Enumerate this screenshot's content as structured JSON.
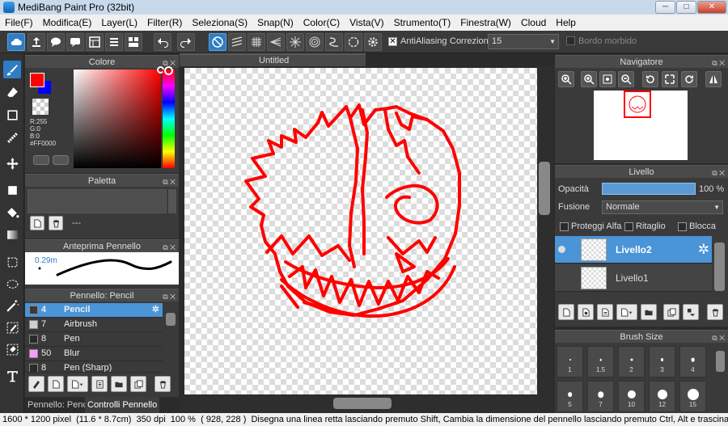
{
  "window": {
    "title": "MediBang Paint Pro (32bit)",
    "minimize": "─",
    "maximize": "□",
    "close": "✕"
  },
  "menu": [
    "File(F)",
    "Modifica(E)",
    "Layer(L)",
    "Filter(R)",
    "Seleziona(S)",
    "Snap(N)",
    "Color(C)",
    "Vista(V)",
    "Strumento(T)",
    "Finestra(W)",
    "Cloud",
    "Help"
  ],
  "toolbar": {
    "antialias_label": "AntiAliasing",
    "correction_label": "Correzione",
    "correction_value": "15",
    "soft_edge_label": "Bordo morbido"
  },
  "color_panel": {
    "title": "Colore",
    "r": "R:255",
    "g": "G:0",
    "b": "B:0",
    "hex": "#FF0000",
    "fg": "#ff0000",
    "bg": "#0000ff"
  },
  "palette_panel": {
    "title": "Paletta",
    "empty_text": "---"
  },
  "brush_preview": {
    "title": "Anteprima Pennello",
    "size": "0.29m"
  },
  "brush_list": {
    "title": "Pennello: Pencil",
    "items": [
      {
        "size": "4",
        "name": "Pencil",
        "swatch": "#3a3a3a"
      },
      {
        "size": "7",
        "name": "Airbrush",
        "swatch": "#cfcfcf"
      },
      {
        "size": "8",
        "name": "Pen",
        "swatch": "#2a2a2a"
      },
      {
        "size": "50",
        "name": "Blur",
        "swatch": "#ff99ff"
      },
      {
        "size": "8",
        "name": "Pen (Sharp)",
        "swatch": "#2a2a2a"
      }
    ],
    "tabs": [
      "Pennello: Pencil",
      "Controlli Pennello"
    ]
  },
  "canvas": {
    "tab_title": "Untitled",
    "stroke_color": "#ff0000"
  },
  "navigator": {
    "title": "Navigatore"
  },
  "layers": {
    "title": "Livello",
    "opacity_label": "Opacità",
    "opacity_value": "100 %",
    "opacity": 1.0,
    "blend_label": "Fusione",
    "blend_value": "Normale",
    "protect_alpha": "Proteggi Alfa",
    "clipping": "Ritaglio",
    "lock": "Blocca",
    "items": [
      {
        "name": "Livello2"
      },
      {
        "name": "Livello1"
      }
    ]
  },
  "brush_size": {
    "title": "Brush Size",
    "sizes": [
      "1",
      "1.5",
      "2",
      "3",
      "4",
      "5",
      "7",
      "10",
      "12",
      "15"
    ]
  },
  "status": {
    "dims": "1600 * 1200 pixel",
    "cm": "(11.6 * 8.7cm)",
    "dpi": "350 dpi",
    "zoom": "100 %",
    "coords": "( 928, 228 )",
    "hint": "Disegna una linea retta lasciando premuto Shift, Cambia la dimensione del pennello lasciando premuto Ctrl, Alt e trascina"
  }
}
